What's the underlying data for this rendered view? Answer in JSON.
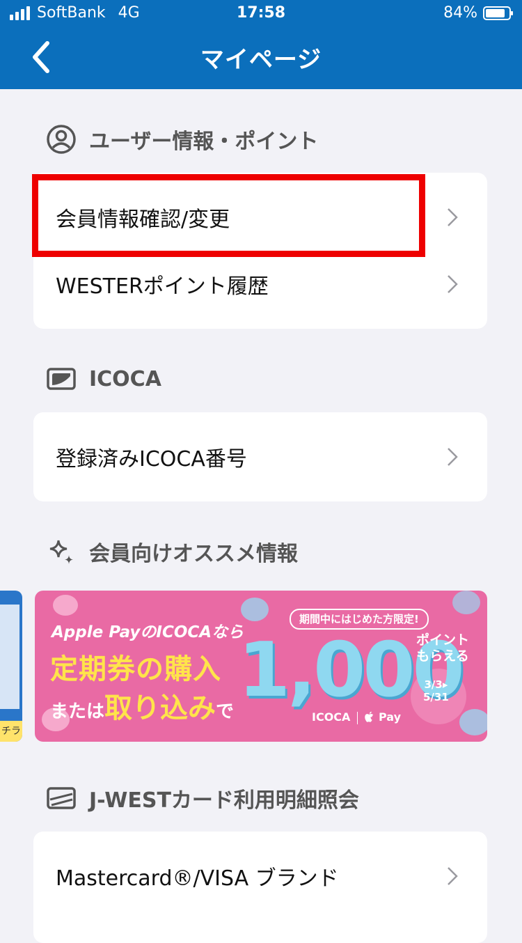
{
  "status": {
    "carrier": "SoftBank",
    "network": "4G",
    "time": "17:58",
    "battery": "84%",
    "battery_level": 0.84
  },
  "nav": {
    "title": "マイページ"
  },
  "sections": {
    "user": {
      "title": "ユーザー情報・ポイント",
      "icon": "user-circle-icon",
      "items": [
        {
          "label": "会員情報確認/変更"
        },
        {
          "label": "WESTERポイント履歴"
        }
      ]
    },
    "icoca": {
      "title": "ICOCA",
      "icon": "card-icon",
      "items": [
        {
          "label": "登録済みICOCA番号"
        }
      ]
    },
    "reco": {
      "title": "会員向けオススメ情報",
      "icon": "sparkle-icon"
    },
    "jwest": {
      "title": "J-WESTカード利用明細照会",
      "icon": "credit-card-icon",
      "items": [
        {
          "label": "Mastercard®/VISA ブランド"
        }
      ]
    }
  },
  "banner": {
    "tag": "期間中にはじめた方限定!",
    "line1": "Apple PayのICOCAなら",
    "line2": "定期券の購入",
    "line3_small": "または",
    "line3_big": "取り込み",
    "line3_end": "で",
    "amount": "1,000",
    "points_line1": "ポイント",
    "points_line2": "もらえる",
    "date_start": "3/3",
    "date_end": "5/31",
    "brand_icoca": "ICOCA",
    "brand_pay": " Pay"
  },
  "peek_banner": {
    "text": "チラ"
  },
  "colors": {
    "header": "#0b6fbc",
    "background": "#f2f2f7",
    "highlight": "#ee0000",
    "banner": "#e96aa4"
  }
}
